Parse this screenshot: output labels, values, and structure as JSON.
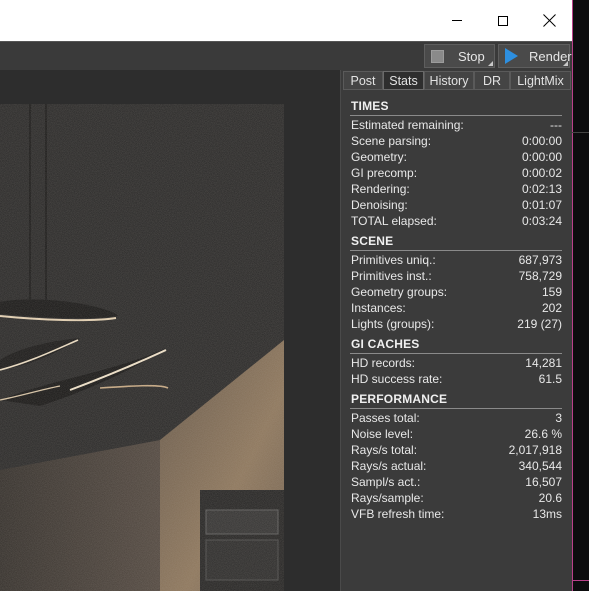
{
  "window": {
    "minimize_icon": "minimize-icon",
    "maximize_icon": "maximize-icon",
    "close_icon": "close-icon"
  },
  "toolbar": {
    "stop_label": "Stop",
    "render_label": "Render",
    "stop_icon": "stop-icon",
    "render_icon": "play-icon",
    "accent_color": "#2d8fe0"
  },
  "tabs": [
    {
      "label": "Post"
    },
    {
      "label": "Stats"
    },
    {
      "label": "History"
    },
    {
      "label": "DR"
    },
    {
      "label": "LightMix"
    }
  ],
  "active_tab": "Stats",
  "sections": [
    {
      "title": "TIMES",
      "rows": [
        {
          "key": "Estimated remaining:",
          "value": "---"
        },
        {
          "key": "Scene parsing:",
          "value": "0:00:00"
        },
        {
          "key": "Geometry:",
          "value": "0:00:00"
        },
        {
          "key": "GI precomp:",
          "value": "0:00:02"
        },
        {
          "key": "Rendering:",
          "value": "0:02:13"
        },
        {
          "key": "Denoising:",
          "value": "0:01:07"
        },
        {
          "key": "TOTAL elapsed:",
          "value": "0:03:24"
        }
      ]
    },
    {
      "title": "SCENE",
      "rows": [
        {
          "key": "Primitives uniq.:",
          "value": "687,973"
        },
        {
          "key": "Primitives inst.:",
          "value": "758,729"
        },
        {
          "key": "Geometry groups:",
          "value": "159"
        },
        {
          "key": "Instances:",
          "value": "202"
        },
        {
          "key": "Lights (groups):",
          "value": "219 (27)"
        }
      ]
    },
    {
      "title": "GI CACHES",
      "rows": [
        {
          "key": "HD records:",
          "value": "14,281"
        },
        {
          "key": "HD success rate:",
          "value": "61.5"
        }
      ]
    },
    {
      "title": "PERFORMANCE",
      "rows": [
        {
          "key": "Passes total:",
          "value": "3"
        },
        {
          "key": "Noise level:",
          "value": "26.6 %"
        },
        {
          "key": "Rays/s total:",
          "value": "2,017,918"
        },
        {
          "key": "Rays/s actual:",
          "value": "340,544"
        },
        {
          "key": "Sampl/s act.:",
          "value": "16,507"
        },
        {
          "key": "Rays/sample:",
          "value": "20.6"
        },
        {
          "key": "VFB refresh time:",
          "value": "13ms"
        }
      ]
    }
  ]
}
